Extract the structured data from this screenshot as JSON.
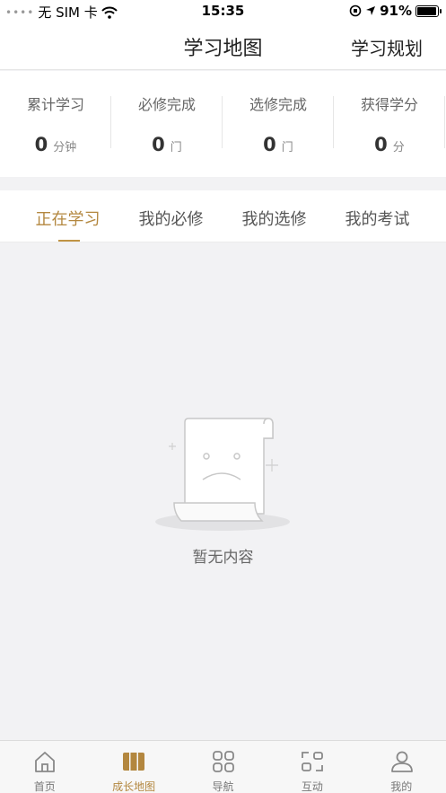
{
  "status_bar": {
    "carrier": "无 SIM 卡",
    "time": "15:35",
    "battery": "91%"
  },
  "nav": {
    "title": "学习地图",
    "right_action": "学习规划"
  },
  "stats": [
    {
      "label": "累计学习",
      "value": "0",
      "unit": "分钟"
    },
    {
      "label": "必修完成",
      "value": "0",
      "unit": "门"
    },
    {
      "label": "选修完成",
      "value": "0",
      "unit": "门"
    },
    {
      "label": "获得学分",
      "value": "0",
      "unit": "分"
    }
  ],
  "tabs": [
    {
      "label": "正在学习",
      "active": true
    },
    {
      "label": "我的必修"
    },
    {
      "label": "我的选修"
    },
    {
      "label": "我的考试"
    }
  ],
  "empty_state": {
    "text": "暂无内容"
  },
  "bottom_nav": [
    {
      "label": "首页",
      "icon": "home-icon"
    },
    {
      "label": "成长地图",
      "icon": "map-icon",
      "active": true
    },
    {
      "label": "导航",
      "icon": "grid-icon"
    },
    {
      "label": "互动",
      "icon": "scan-icon"
    },
    {
      "label": "我的",
      "icon": "user-icon"
    }
  ],
  "colors": {
    "accent": "#b3873f",
    "background": "#f2f2f4"
  }
}
